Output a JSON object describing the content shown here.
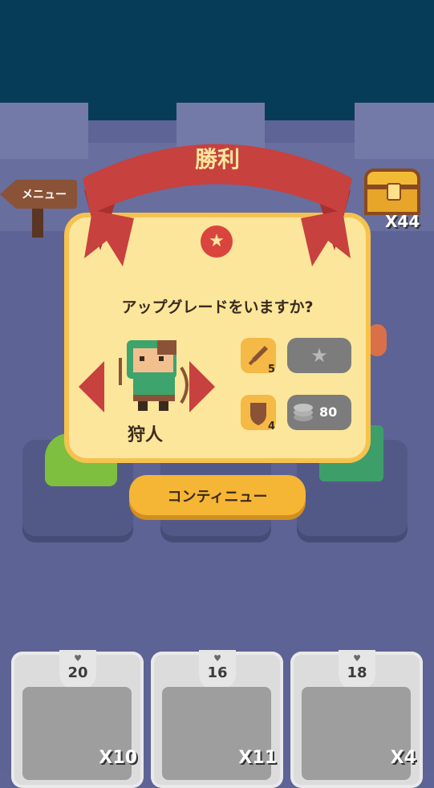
{
  "banner": {
    "title": "勝利"
  },
  "menu": {
    "label": "メニュー"
  },
  "chest": {
    "count": "X44"
  },
  "dialog": {
    "prompt": "アップグレードをいますか?",
    "character_name": "狩人",
    "attack": {
      "value": "5"
    },
    "defense": {
      "value": "4"
    },
    "upgrade_cost": "80"
  },
  "continue_button": {
    "label": "コンティニュー"
  },
  "cards": [
    {
      "hp": "20",
      "qty": "X10"
    },
    {
      "hp": "16",
      "qty": "X11"
    },
    {
      "hp": "18",
      "qty": "X4"
    }
  ],
  "icons": {
    "heart": "♥",
    "star": "★"
  },
  "colors": {
    "sky": "#073c58",
    "floor": "#5d6395",
    "banner_red": "#c7413e",
    "dialog_bg": "#fbe69b",
    "dialog_border": "#f6c24f",
    "button_yellow": "#f5b535",
    "disabled_grey": "#7c7c7c"
  }
}
